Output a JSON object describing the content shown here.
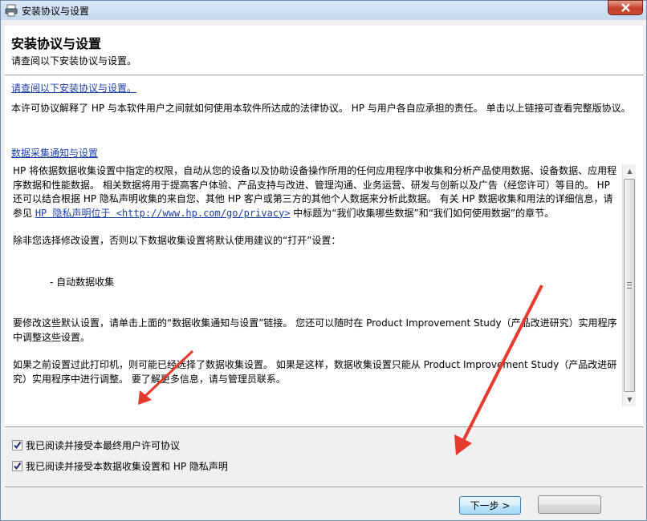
{
  "window": {
    "title": "安装协议与设置"
  },
  "header": {
    "title": "安装协议与设置",
    "subtitle": "请查阅以下安装协议与设置。"
  },
  "content": {
    "license_link": "请查阅以下安装协议与设置。",
    "license_text": "本许可协议解释了 HP 与本软件用户之间就如何使用本软件所达成的法律协议。 HP 与用户各自应承担的责任。 单击以上链接可查看完整版协议。",
    "data_link": "数据采集通知与设置",
    "data_p1_a": "HP 将依据数据收集设置中指定的权限，自动从您的设备以及协助设备操作所用的任何应用程序中收集和分析产品使用数据、设备数据、应用程序数据和性能数据。 相关数据将用于提高客户体验、产品支持与改进、管理沟通、业务运营、研发与创新以及广告（经您许可）等目的。 HP 还可以结合根据 HP 隐私声明收集的来自您、其他 HP 客户或第三方的其他个人数据来分析此数据。 有关 HP 数据收集和用法的详细信息，请参见 ",
    "privacy_link": "HP 隐私声明位于 <http://www.hp.com/go/privacy>",
    "data_p1_b": " 中标题为“我们收集哪些数据”和“我们如何使用数据”的章节。",
    "data_p2": "除非您选择修改设置，否则以下数据收集设置将默认使用建议的“打开”设置：",
    "data_item": "- 自动数据收集",
    "data_p3": "要修改这些默认设置，请单击上面的“数据收集通知与设置”链接。 您还可以随时在 Product Improvement Study（产品改进研究）实用程序中调整这些设置。",
    "data_p4": "如果之前设置过此打印机，则可能已经选择了数据收集设置。 如果是这样，数据收集设置只能从 Product Improvement Study（产品改进研究）实用程序中进行调整。 要了解更多信息，请与管理员联系。"
  },
  "checkboxes": [
    {
      "label": "我已阅读并接受本最终用户许可协议",
      "checked": true
    },
    {
      "label": "我已阅读并接受本数据收集设置和 HP 隐私声明",
      "checked": true
    }
  ],
  "buttons": {
    "next_label": "下一步 >"
  },
  "colors": {
    "link": "#1a3fa6",
    "annotation_arrow": "#e53a2e"
  }
}
